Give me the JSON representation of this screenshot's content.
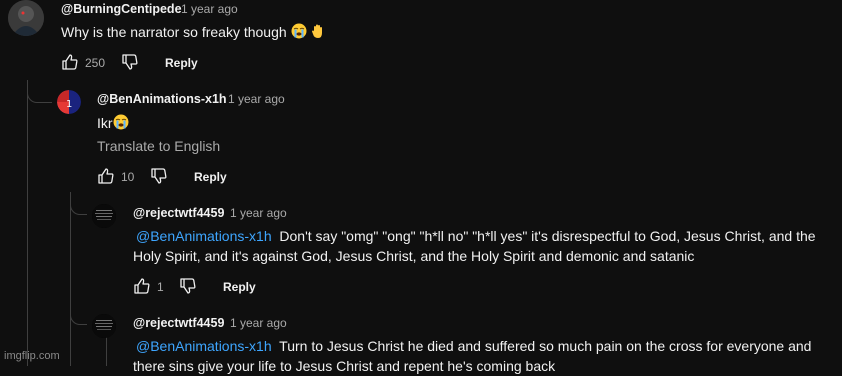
{
  "comments": [
    {
      "handle": "@BurningCentipede",
      "time": "1 year ago",
      "text": "Why is the narrator so freaky though",
      "likes": "250",
      "reply_label": "Reply"
    },
    {
      "handle": "@BenAnimations-x1h",
      "time": "1 year ago",
      "text": "Ikr",
      "translate_label": "Translate to English",
      "likes": "10",
      "reply_label": "Reply"
    },
    {
      "handle": "@rejectwtf4459",
      "time": "1 year ago",
      "mention": "@BenAnimations-x1h",
      "text": "Don't say \"omg\" \"ong\" \"h*ll no\" \"h*ll yes\" it's disrespectful to God, Jesus Christ, and the Holy Spirit, and it's against God, Jesus Christ, and the Holy Spirit and demonic and satanic",
      "likes": "1",
      "reply_label": "Reply"
    },
    {
      "handle": "@rejectwtf4459",
      "time": "1 year ago",
      "mention": "@BenAnimations-x1h",
      "text": "Turn to Jesus Christ he died and suffered so much pain on the cross for everyone and there sins give your life to Jesus Christ and repent he's coming back"
    }
  ],
  "watermark": "imgflip.com",
  "icons": {
    "like": "thumbs-up-icon",
    "dislike": "thumbs-down-icon",
    "emoji1": "loudly-crying-face-emoji",
    "emoji2": "raised-hand-emoji"
  }
}
